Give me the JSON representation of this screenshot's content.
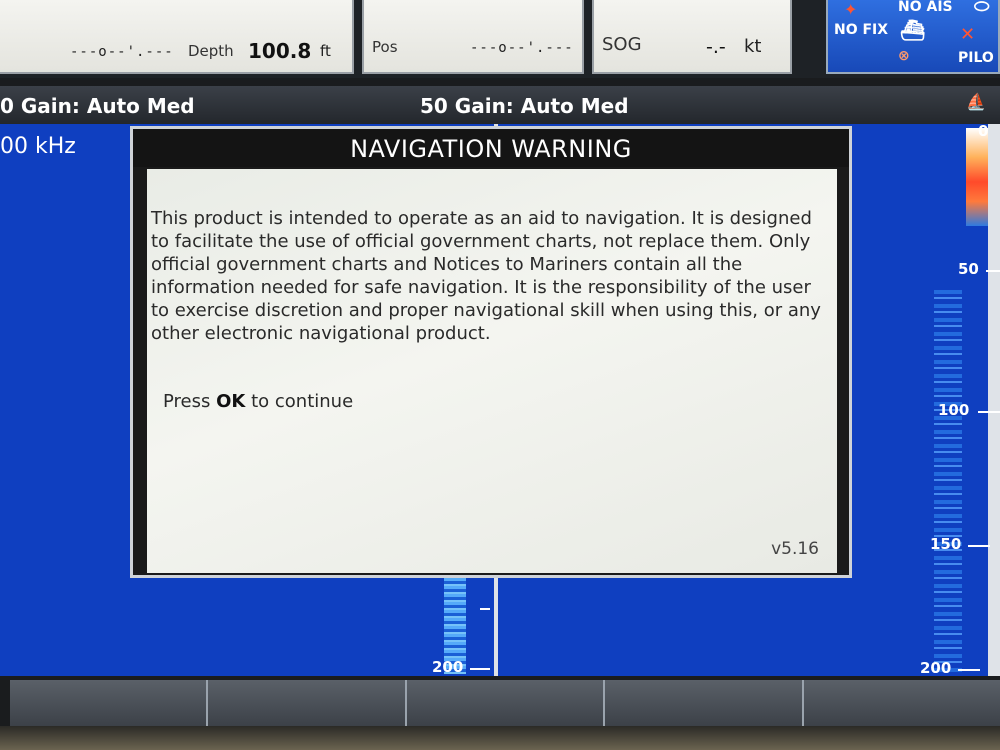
{
  "top_panels": {
    "depth": {
      "placeholder": "---o--'.---",
      "label": "Depth",
      "value": "100.8",
      "unit": "ft"
    },
    "pos": {
      "label": "Pos",
      "value": "---o--'.---"
    },
    "sog": {
      "label": "SOG",
      "value": "-.-",
      "unit": "kt"
    }
  },
  "status": {
    "no_ais": "NO AIS",
    "no_fix": "NO FIX",
    "pilot": "PILO"
  },
  "gain": {
    "left": "0 Gain: Auto Med",
    "right": "50 Gain: Auto Med"
  },
  "frequency_label": "00 kHz",
  "depth_scale": {
    "top": "0",
    "marks": [
      "50",
      "100",
      "150",
      "200"
    ],
    "left_bottom": "200"
  },
  "dialog": {
    "title": "NAVIGATION WARNING",
    "body": "This product is intended to operate as an aid to navigation. It is designed to facilitate the use of official government charts, not replace them.  Only official government charts and Notices to Mariners contain all the information needed for safe navigation. It is the responsibility of the user to exercise discretion and proper navigational skill when using this, or any other electronic navigational product.",
    "press_prefix": "Press",
    "press_key": "OK",
    "press_suffix": "to continue",
    "version": "v5.16"
  },
  "colors": {
    "sonar_water": "#0f3fc0",
    "status_blue": "#1849b8",
    "dialog_title_bg": "#141414"
  }
}
